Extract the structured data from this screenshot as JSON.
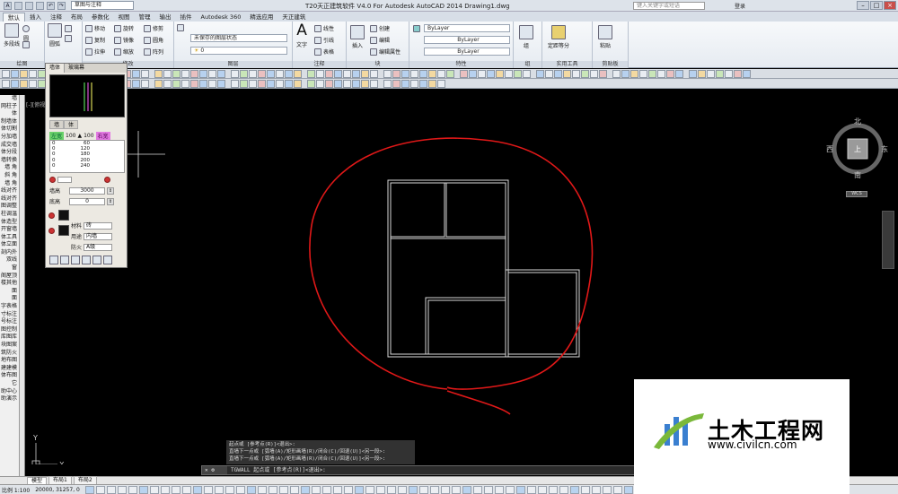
{
  "app": {
    "title": "T20天正建筑软件 V4.0 For Autodesk AutoCAD 2014    Drawing1.dwg",
    "workspace": "草图与注释",
    "search_placeholder": "键入关键字或短语",
    "login": "登录"
  },
  "ribbon_tabs": [
    "默认",
    "插入",
    "注释",
    "布局",
    "参数化",
    "视图",
    "管理",
    "输出",
    "插件",
    "Autodesk 360",
    "精选应用",
    "天正建筑"
  ],
  "ribbon": {
    "draw": {
      "label": "绘图",
      "polyline": "多段线",
      "circle": "圆",
      "arc": "圆弧"
    },
    "modify": {
      "label": "修改",
      "move": "移动",
      "rotate": "旋转",
      "trim": "修剪",
      "copy": "复制",
      "mirror": "镜像",
      "fillet": "圆角",
      "stretch": "拉伸",
      "scale": "缩放",
      "array": "阵列"
    },
    "layer": {
      "label": "图层",
      "state": "未保存的图层状态",
      "current": "0"
    },
    "annotation": {
      "label": "注释",
      "text": "文字",
      "linear": "线性",
      "leader": "引线",
      "table": "表格"
    },
    "block": {
      "label": "块",
      "insert": "插入",
      "create": "创建",
      "edit": "编辑",
      "edit_attr": "编辑属性"
    },
    "properties": {
      "label": "特性",
      "color": "ByLayer",
      "linetype": "ByLayer",
      "lineweight": "ByLayer"
    },
    "groups": {
      "label": "组",
      "group": "组"
    },
    "utilities": {
      "label": "实用工具",
      "measure": "定距等分"
    },
    "clipboard": {
      "label": "剪贴板",
      "paste": "粘贴"
    }
  },
  "viewport_label": "[-][俯视]",
  "left_menu": [
    "墙",
    "网柱子",
    "体",
    "制墙体",
    "体切割",
    "分加墙",
    "成交墙",
    "体分段",
    "墙转换",
    "墙 角",
    "斜 角",
    "墙 角",
    "线对齐",
    "线对齐",
    "图调整",
    "柱调温",
    "体造型",
    "开窗墙",
    "体工具",
    "体立面",
    "剖内外",
    "双线",
    "窗",
    "阁屋顶",
    "楼其他",
    "面",
    "面",
    "字表格",
    "寸标注",
    "号标注",
    "图控制",
    "库图库",
    "块图案",
    "筑防火",
    "地布图",
    "建建模",
    "体布图",
    "它",
    "助中心",
    "助演示"
  ],
  "palette": {
    "tabs": [
      "墙体",
      "玻璃幕"
    ],
    "sub_tabs": [
      "墙",
      "体"
    ],
    "left_label": "左宽",
    "left_value": "100",
    "right_value": "100",
    "right_label": "右宽",
    "list": [
      [
        "0",
        "60"
      ],
      [
        "0",
        "120"
      ],
      [
        "0",
        "180"
      ],
      [
        "0",
        "200"
      ],
      [
        "0",
        "240"
      ]
    ],
    "height_label": "墙高",
    "height_value": "3000",
    "base_label": "底高",
    "base_value": "0",
    "material_label": "材料",
    "material_value": "砖",
    "usage_label": "用途",
    "usage_value": "内墙",
    "fire_label": "防火",
    "fire_value": "A级"
  },
  "viewcube": {
    "north": "北",
    "south": "南",
    "east": "东",
    "west": "西",
    "top": "上",
    "wcs": "WCS"
  },
  "command": {
    "history": [
      "起点或 [参考点(R)]<退出>:",
      "直墙下一点或 [弧墙(A)/矩形画墙(R)/闭合(C)/回退(U)]<另一段>:",
      "直墙下一点或 [弧墙(A)/矩形画墙(R)/闭合(C)/回退(U)]<另一段>:"
    ],
    "prompt": "TGWALL 起点或 [参考点(R)]<退出>:"
  },
  "layout_tabs": [
    "模型",
    "布局1",
    "布局2"
  ],
  "status": {
    "scale": "比例 1:100",
    "coords": "20000, 31257, 0"
  },
  "watermark": {
    "title": "土木工程网",
    "url": "www.civilcn.com"
  },
  "colors": {
    "annotation": "#e01818",
    "walls": "#d8d8d8",
    "ribbon_bg": "#eef2f6"
  }
}
